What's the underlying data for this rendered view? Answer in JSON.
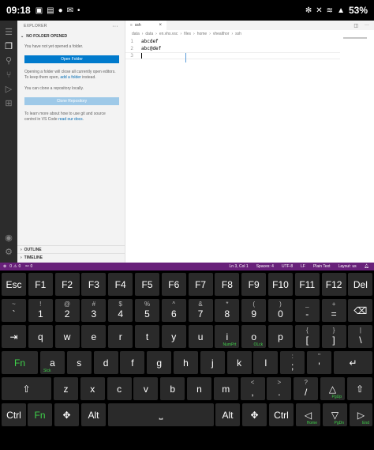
{
  "statusbar": {
    "time": "09:18",
    "battery": "53%",
    "left_icons": [
      "chat-icon",
      "image-icon",
      "video-icon",
      "mail-icon",
      "dot-icon"
    ],
    "right_icons": [
      "bluetooth-icon",
      "mute-icon",
      "wifi-icon",
      "signal-icon"
    ]
  },
  "sidebar": {
    "title": "EXPLORER",
    "section": "NO FOLDER OPENED",
    "not_opened_text": "You have not yet opened a folder.",
    "open_folder_label": "Open Folder",
    "close_editors_text_1": "Opening a folder will close all currently open editors. To keep them open,",
    "add_folder_link": "add a folder",
    "close_editors_text_2": "instead.",
    "clone_text": "You can clone a repository locally.",
    "clone_label": "Clone Repository",
    "learn_text_1": "To learn more about how to use git and source control in VS Code",
    "docs_link": "read our docs",
    "learn_text_2": ".",
    "outline": "OUTLINE",
    "timeline": "TIMELINE"
  },
  "editor": {
    "tab_name": "ssh",
    "breadcrumb": [
      "data",
      "data",
      "en.vhs.vsc",
      "files",
      "home",
      "vhealthor",
      "ssh"
    ],
    "lines": [
      {
        "num": "1",
        "text": "abcdef"
      },
      {
        "num": "2",
        "text": "abc@def"
      },
      {
        "num": "3",
        "text": ""
      }
    ]
  },
  "vstatus": {
    "errors": "0",
    "warnings": "0",
    "ports": "0",
    "position": "Ln 3, Col 1",
    "spaces": "Spaces: 4",
    "encoding": "UTF-8",
    "eol": "LF",
    "language": "Plain Text",
    "layout": "Layout: us"
  },
  "keyboard": {
    "row1": [
      "Esc",
      "F1",
      "F2",
      "F3",
      "F4",
      "F5",
      "F6",
      "F7",
      "F8",
      "F9",
      "F10",
      "F11",
      "F12",
      "Del"
    ],
    "row2": [
      {
        "main": "`",
        "sup": "~"
      },
      {
        "main": "1",
        "sup": "!"
      },
      {
        "main": "2",
        "sup": "@"
      },
      {
        "main": "3",
        "sup": "#"
      },
      {
        "main": "4",
        "sup": "$"
      },
      {
        "main": "5",
        "sup": "%"
      },
      {
        "main": "6",
        "sup": "^"
      },
      {
        "main": "7",
        "sup": "&"
      },
      {
        "main": "8",
        "sup": "*"
      },
      {
        "main": "9",
        "sup": "("
      },
      {
        "main": "0",
        "sup": ")"
      },
      {
        "main": "-",
        "sup": "_"
      },
      {
        "main": "=",
        "sup": "+"
      },
      {
        "main": "⌫",
        "sup": ""
      }
    ],
    "row3": [
      {
        "main": "⇥",
        "sup": ""
      },
      {
        "main": "q"
      },
      {
        "main": "w"
      },
      {
        "main": "e"
      },
      {
        "main": "r"
      },
      {
        "main": "t"
      },
      {
        "main": "y"
      },
      {
        "main": "u"
      },
      {
        "main": "i",
        "sub": "NumPrt"
      },
      {
        "main": "o",
        "sub": "OLck"
      },
      {
        "main": "p"
      },
      {
        "main": "[",
        "sup": "{"
      },
      {
        "main": "]",
        "sup": "}"
      },
      {
        "main": "\\",
        "sup": "|"
      }
    ],
    "row4": [
      {
        "main": "Fn"
      },
      {
        "main": "a",
        "sub": "Slck"
      },
      {
        "main": "s"
      },
      {
        "main": "d"
      },
      {
        "main": "f"
      },
      {
        "main": "g"
      },
      {
        "main": "h"
      },
      {
        "main": "j"
      },
      {
        "main": "k"
      },
      {
        "main": "l"
      },
      {
        "main": ";",
        "sup": ":"
      },
      {
        "main": "'",
        "sup": "\""
      },
      {
        "main": "↵"
      }
    ],
    "row5": [
      {
        "main": "⇧"
      },
      {
        "main": "z"
      },
      {
        "main": "x"
      },
      {
        "main": "c"
      },
      {
        "main": "v"
      },
      {
        "main": "b"
      },
      {
        "main": "n"
      },
      {
        "main": "m"
      },
      {
        "main": ",",
        "sup": "<"
      },
      {
        "main": ".",
        "sup": ">"
      },
      {
        "main": "/",
        "sup": "?"
      },
      {
        "main": "△",
        "sub": "PgUp"
      },
      {
        "main": "⇧"
      }
    ],
    "row6": [
      {
        "main": "Ctrl"
      },
      {
        "main": "Fn"
      },
      {
        "main": "✥"
      },
      {
        "main": "Alt"
      },
      {
        "main": "⎵"
      },
      {
        "main": "Alt"
      },
      {
        "main": "✥"
      },
      {
        "main": "Ctrl"
      },
      {
        "main": "◁",
        "sub": "Home"
      },
      {
        "main": "▽",
        "sub": "PgDn"
      },
      {
        "main": "▷",
        "sub": "End"
      }
    ]
  },
  "colors": {
    "activitybar": "#2c2c2c",
    "sidebar": "#f3f3f3",
    "primary_button": "#007acc",
    "statusbar_purple": "#68217a",
    "key_bg": "#2a2a2a",
    "key_green": "#3fd14a"
  }
}
